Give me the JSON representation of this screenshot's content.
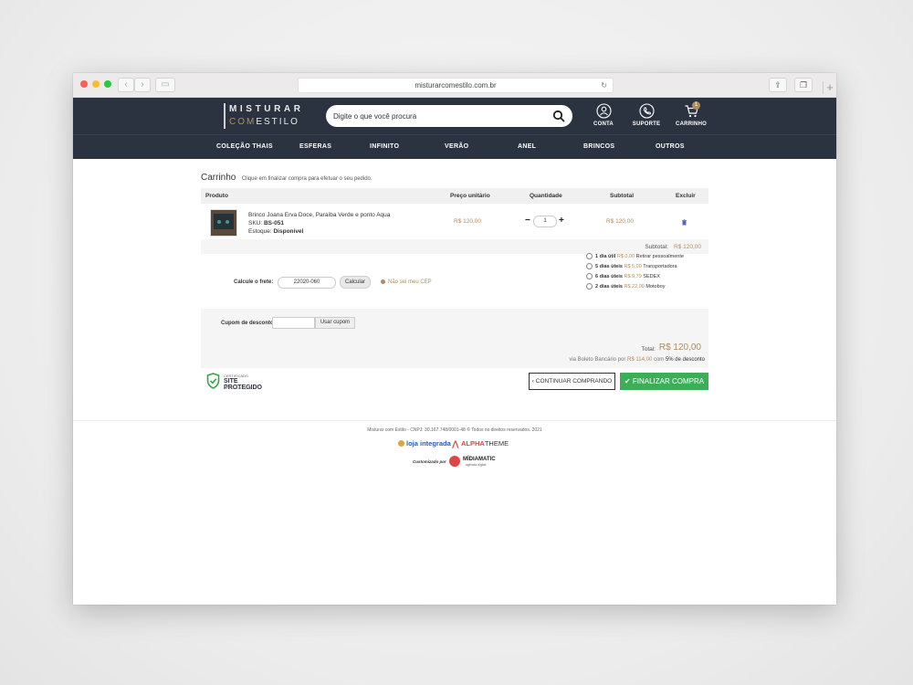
{
  "browser": {
    "url": "misturarcomestilo.com.br"
  },
  "header": {
    "logo_line1": "MISTURAR",
    "logo_com": "COM",
    "logo_line2": "ESTILO",
    "search_placeholder": "Digite o que você procura",
    "account_label": "CONTA",
    "support_label": "SUPORTE",
    "cart_label": "CARRINHO",
    "cart_count": "1"
  },
  "nav": {
    "items": [
      "COLEÇÃO THAIS",
      "ESFERAS",
      "INFINITO",
      "VERÃO",
      "ANEL",
      "BRINCOS",
      "OUTROS"
    ]
  },
  "cart": {
    "title": "Carrinho",
    "subtitle": "Clique em finalizar compra para efetuar o seu pedido.",
    "columns": {
      "product": "Produto",
      "unit_price": "Preço unitário",
      "quantity": "Quantidade",
      "subtotal": "Subtotal",
      "remove": "Excluir"
    },
    "item": {
      "name": "Brinco Joana Erva Doce, Paraíba Verde e ponto Aqua",
      "sku_label": "SKU:",
      "sku": "BS-051",
      "stock_label": "Estoque:",
      "stock": "Disponível",
      "unit_price": "R$ 120,00",
      "quantity": "1",
      "subtotal": "R$ 120,00"
    },
    "subtotal_label": "Subtotal:",
    "subtotal_value": "R$ 120,00"
  },
  "freight": {
    "label": "Calcule o frete:",
    "cep": "22020-060",
    "calc_button": "Calcular",
    "dont_know_cep": "Não sei meu CEP",
    "options": [
      {
        "days": "1 dia útil",
        "price": "R$ 0,00",
        "name": "Retirar pessoalmente"
      },
      {
        "days": "5 dias úteis",
        "price": "R$ 5,00",
        "name": "Transportadora"
      },
      {
        "days": "6 dias úteis",
        "price": "R$ 9,79",
        "name": "SEDEX"
      },
      {
        "days": "2 dias úteis",
        "price": "R$ 22,00",
        "name": "Motoboy"
      }
    ]
  },
  "coupon": {
    "label": "Cupom de desconto:",
    "value": "",
    "button": "Usar cupom"
  },
  "total": {
    "label": "Total:",
    "value": "R$ 120,00",
    "boleto_prefix": "via Boleto Bancário por",
    "boleto_value": "R$ 114,00",
    "boleto_middle": "com",
    "boleto_discount": "5% de desconto"
  },
  "seal": {
    "line1": "CERTIFICADO",
    "line2": "SITE PROTEGIDO",
    "line3": "CERTIFICADO SSL"
  },
  "actions": {
    "continue": "CONTINUAR COMPRANDO",
    "finish": "FINALIZAR COMPRA"
  },
  "footer": {
    "copyright": "Misturar com Estilo - CNPJ: 30.167.748/0001-48 © Todos os direitos reservados. 2021",
    "loja_integrada": "loja integrada",
    "alpha": "ALPHA",
    "theme": "THEME",
    "customized_by": "Customizado por",
    "midiamatic": "MÍDIAMATIC",
    "midiamatic_sub": "agência digital"
  },
  "colors": {
    "header_bg": "#2b3340",
    "accent_gold": "#b08d5b",
    "finish_green": "#3dae58"
  }
}
